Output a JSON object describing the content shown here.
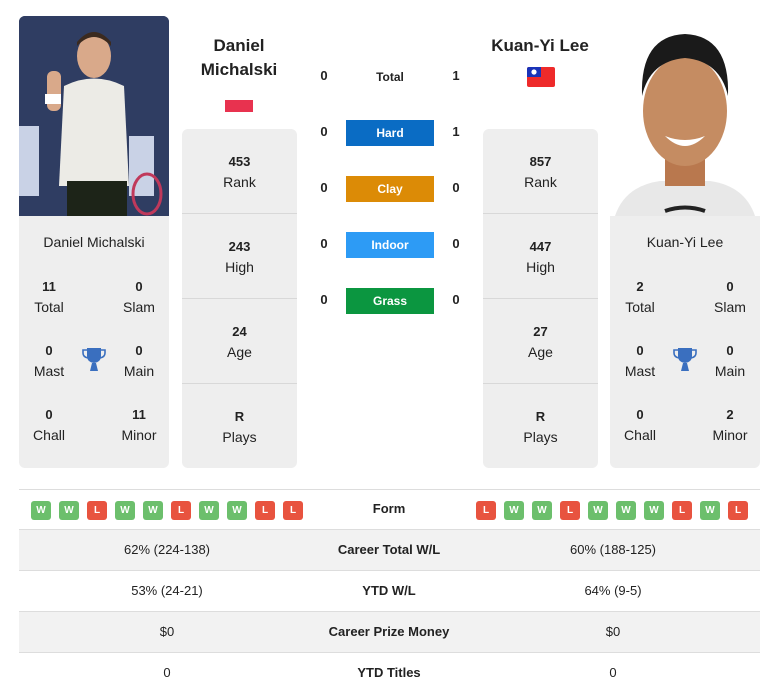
{
  "players": {
    "left": {
      "name": "Daniel Michalski",
      "name_line1": "Daniel",
      "name_line2": "Michalski",
      "flag": "Poland",
      "rank": "453",
      "rank_label": "Rank",
      "high": "243",
      "high_label": "High",
      "age": "24",
      "age_label": "Age",
      "plays": "R",
      "plays_label": "Plays",
      "titles": {
        "total": "11",
        "total_label": "Total",
        "slam": "0",
        "slam_label": "Slam",
        "mast": "0",
        "mast_label": "Mast",
        "main": "0",
        "main_label": "Main",
        "chall": "0",
        "chall_label": "Chall",
        "minor": "11",
        "minor_label": "Minor"
      },
      "form": [
        "W",
        "W",
        "L",
        "W",
        "W",
        "L",
        "W",
        "W",
        "L",
        "L"
      ]
    },
    "right": {
      "name": "Kuan-Yi Lee",
      "flag": "Taiwan",
      "rank": "857",
      "rank_label": "Rank",
      "high": "447",
      "high_label": "High",
      "age": "27",
      "age_label": "Age",
      "plays": "R",
      "plays_label": "Plays",
      "titles": {
        "total": "2",
        "total_label": "Total",
        "slam": "0",
        "slam_label": "Slam",
        "mast": "0",
        "mast_label": "Mast",
        "main": "0",
        "main_label": "Main",
        "chall": "0",
        "chall_label": "Chall",
        "minor": "2",
        "minor_label": "Minor"
      },
      "form": [
        "L",
        "W",
        "W",
        "L",
        "W",
        "W",
        "W",
        "L",
        "W",
        "L"
      ]
    }
  },
  "h2h": [
    {
      "label": "Total",
      "left": "0",
      "right": "1",
      "color": ""
    },
    {
      "label": "Hard",
      "left": "0",
      "right": "1",
      "color": "#0a6cc4"
    },
    {
      "label": "Clay",
      "left": "0",
      "right": "0",
      "color": "#dc8b06"
    },
    {
      "label": "Indoor",
      "left": "0",
      "right": "0",
      "color": "#2d9bf5"
    },
    {
      "label": "Grass",
      "left": "0",
      "right": "0",
      "color": "#0b9640"
    }
  ],
  "form_label": "Form",
  "comparison": [
    {
      "label": "Career Total W/L",
      "left": "62% (224-138)",
      "right": "60% (188-125)"
    },
    {
      "label": "YTD W/L",
      "left": "53% (24-21)",
      "right": "64% (9-5)"
    },
    {
      "label": "Career Prize Money",
      "left": "$0",
      "right": "$0"
    },
    {
      "label": "YTD Titles",
      "left": "0",
      "right": "0"
    }
  ],
  "colors": {
    "win": "#6cbf6c",
    "loss": "#e8533f",
    "trophy": "#3a6fbf",
    "card_bg": "#eeeeee"
  }
}
